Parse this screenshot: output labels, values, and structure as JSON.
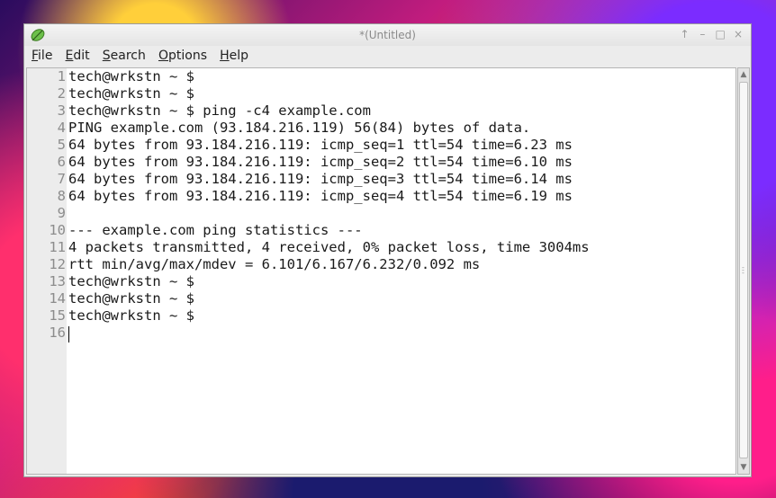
{
  "window": {
    "title": "*(Untitled)"
  },
  "window_controls": {
    "up": "↑",
    "minimize": "–",
    "maximize": "□",
    "close": "×"
  },
  "menu": [
    {
      "label": "File",
      "underline": "F",
      "rest": "ile"
    },
    {
      "label": "Edit",
      "underline": "E",
      "rest": "dit"
    },
    {
      "label": "Search",
      "underline": "S",
      "rest": "earch"
    },
    {
      "label": "Options",
      "underline": "O",
      "rest": "ptions"
    },
    {
      "label": "Help",
      "underline": "H",
      "rest": "elp"
    }
  ],
  "editor": {
    "lines": [
      {
        "n": "1",
        "t": "tech@wrkstn ~ $"
      },
      {
        "n": "2",
        "t": "tech@wrkstn ~ $"
      },
      {
        "n": "3",
        "t": "tech@wrkstn ~ $ ping -c4 example.com"
      },
      {
        "n": "4",
        "t": "PING example.com (93.184.216.119) 56(84) bytes of data."
      },
      {
        "n": "5",
        "t": "64 bytes from 93.184.216.119: icmp_seq=1 ttl=54 time=6.23 ms"
      },
      {
        "n": "6",
        "t": "64 bytes from 93.184.216.119: icmp_seq=2 ttl=54 time=6.10 ms"
      },
      {
        "n": "7",
        "t": "64 bytes from 93.184.216.119: icmp_seq=3 ttl=54 time=6.14 ms"
      },
      {
        "n": "8",
        "t": "64 bytes from 93.184.216.119: icmp_seq=4 ttl=54 time=6.19 ms"
      },
      {
        "n": "9",
        "t": ""
      },
      {
        "n": "10",
        "t": "--- example.com ping statistics ---"
      },
      {
        "n": "11",
        "t": "4 packets transmitted, 4 received, 0% packet loss, time 3004ms"
      },
      {
        "n": "12",
        "t": "rtt min/avg/max/mdev = 6.101/6.167/6.232/0.092 ms"
      },
      {
        "n": "13",
        "t": "tech@wrkstn ~ $"
      },
      {
        "n": "14",
        "t": "tech@wrkstn ~ $"
      },
      {
        "n": "15",
        "t": "tech@wrkstn ~ $"
      },
      {
        "n": "16",
        "t": ""
      }
    ]
  }
}
